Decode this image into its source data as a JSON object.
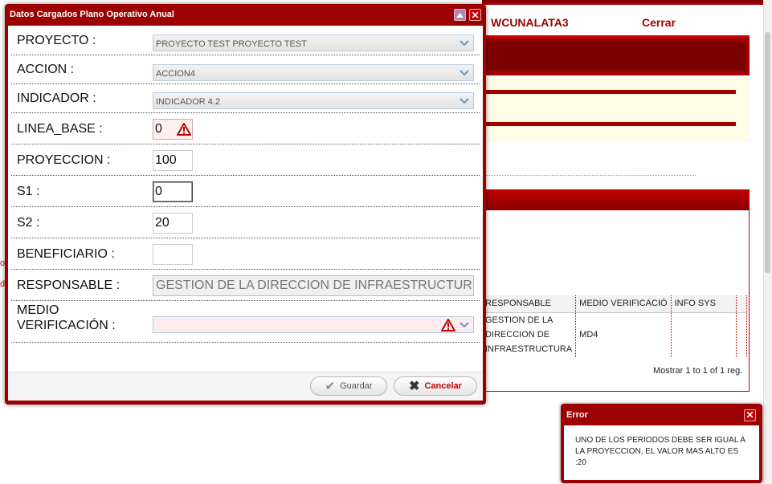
{
  "background": {
    "user_label": "WCUNALATA3",
    "close_label": "Cerrar",
    "table": {
      "headers": [
        "RESPONSABLE",
        "MEDIO VERIFICACIÓ",
        "INFO SYS"
      ],
      "row": {
        "responsable": "GESTION DE LA DIRECCION DE INFRAESTRUCTURA",
        "medio": "MD4",
        "info": ""
      }
    },
    "pager": "Mostrar 1 to 1 of 1 reg.",
    "left_stub_1": "o",
    "left_stub_2": "di"
  },
  "dialog": {
    "title": "Datos Cargados Plano Operativo Anual",
    "fields": {
      "proyecto": {
        "label": "PROYECTO :",
        "value": "PROYECTO TEST PROYECTO TEST"
      },
      "accion": {
        "label": "ACCION :",
        "value": "ACCION4"
      },
      "indicador": {
        "label": "INDICADOR :",
        "value": "INDICADOR 4.2"
      },
      "linea_base": {
        "label": "LINEA_BASE :",
        "value": "0"
      },
      "proyeccion": {
        "label": "PROYECCION :",
        "value": "100"
      },
      "s1": {
        "label": "S1 :",
        "value": "0"
      },
      "s2": {
        "label": "S2 :",
        "value": "20"
      },
      "beneficiario": {
        "label": "BENEFICIARIO :",
        "value": ""
      },
      "responsable": {
        "label": "RESPONSABLE :",
        "value": "GESTION DE LA DIRECCION DE INFRAESTRUCTUR"
      },
      "medio": {
        "label_line1": "MEDIO",
        "label_line2": "VERIFICACIÓN :",
        "value": ""
      }
    },
    "buttons": {
      "save": "Guardar",
      "cancel": "Cancelar"
    }
  },
  "error_toast": {
    "title": "Error",
    "message": "UNO DE LOS PERIODOS DEBE SER IGUAL A LA PROYECCION, EL VALOR MAS ALTO ES :20"
  },
  "colors": {
    "brand": "#9c0000",
    "accent": "#c70000",
    "error_bg": "#fdecec"
  },
  "icons": [
    "minimize-icon",
    "close-icon",
    "chevron-down-icon",
    "warning-icon",
    "check-icon",
    "cancel-x-icon"
  ]
}
